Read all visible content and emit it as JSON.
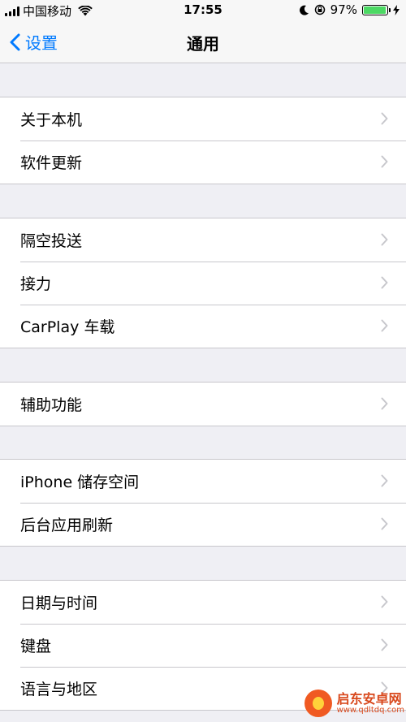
{
  "status": {
    "carrier": "中国移动",
    "time": "17:55",
    "battery": "97%",
    "battery_level": 0.97
  },
  "nav": {
    "back_label": "设置",
    "title": "通用"
  },
  "groups": [
    {
      "items": [
        {
          "label": "关于本机"
        },
        {
          "label": "软件更新"
        }
      ]
    },
    {
      "items": [
        {
          "label": "隔空投送"
        },
        {
          "label": "接力"
        },
        {
          "label": "CarPlay 车载"
        }
      ]
    },
    {
      "items": [
        {
          "label": "辅助功能"
        }
      ]
    },
    {
      "items": [
        {
          "label": "iPhone 储存空间"
        },
        {
          "label": "后台应用刷新"
        }
      ]
    },
    {
      "items": [
        {
          "label": "日期与时间"
        },
        {
          "label": "键盘"
        },
        {
          "label": "语言与地区"
        }
      ]
    }
  ],
  "watermark": {
    "title": "启东安卓网",
    "url": "www.qdltdq.com"
  },
  "colors": {
    "accent": "#007aff",
    "background": "#efeff4",
    "separator": "#c8c7cc",
    "battery": "#4cd964"
  }
}
